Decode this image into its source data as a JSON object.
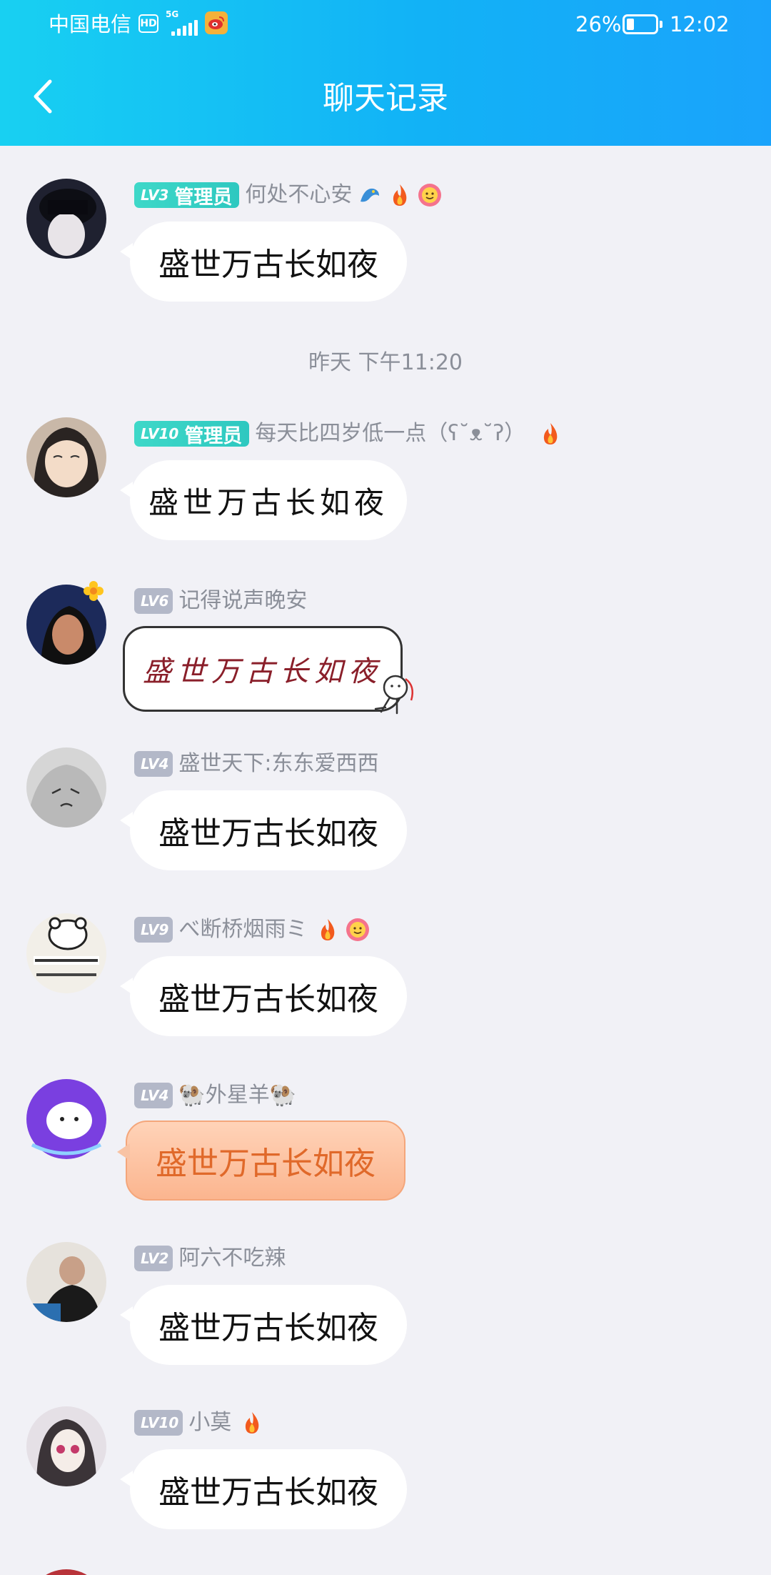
{
  "status_bar": {
    "carrier": "中国电信",
    "hd": "HD",
    "network": "5G",
    "battery_percent": "26%",
    "battery_level": 0.26,
    "time": "12:02",
    "icons": [
      "hd-icon",
      "signal-icon",
      "weibo-icon",
      "battery-icon"
    ]
  },
  "nav": {
    "title": "聊天记录",
    "back_icon": "chevron-left-icon"
  },
  "time_divider": "昨天 下午11:20",
  "messages": [
    {
      "level": "LV3",
      "role": "管理员",
      "nickname": "何处不心安",
      "emojis": [
        "dragon-emoji",
        "fire-emoji",
        "flower-emoji"
      ],
      "text": "盛世万古长如夜",
      "style": "plain",
      "avatar_color": "#1f2130"
    },
    {
      "level": "LV10",
      "role": "管理员",
      "nickname": "每天比四岁低一点（ʕ˘ᴥ˘ʔ）",
      "emojis": [
        "fire-emoji"
      ],
      "text": "盛世万古长如夜",
      "style": "calli",
      "avatar_color": "#c9b8a8"
    },
    {
      "level": "LV6",
      "role": "",
      "nickname": "记得说声晚安",
      "emojis": [],
      "text": "盛世万古长如夜",
      "style": "hand",
      "avatar_color": "#1c2a5a"
    },
    {
      "level": "LV4",
      "role": "",
      "nickname": "盛世天下:东东爱西西",
      "emojis": [],
      "text": "盛世万古长如夜",
      "style": "plain",
      "avatar_color": "#cfcfcf"
    },
    {
      "level": "LV9",
      "role": "",
      "nickname": "べ断桥烟雨ミ",
      "emojis": [
        "fire-emoji",
        "flower-emoji"
      ],
      "text": "盛世万古长如夜",
      "style": "plain",
      "avatar_color": "#e8e4e0"
    },
    {
      "level": "LV4",
      "role": "",
      "nickname": "🐏外星羊🐏",
      "emojis": [],
      "text": "盛世万古长如夜",
      "style": "orange",
      "avatar_color": "#7a3fe0"
    },
    {
      "level": "LV2",
      "role": "",
      "nickname": "阿六不吃辣",
      "emojis": [],
      "text": "盛世万古长如夜",
      "style": "plain",
      "avatar_color": "#6b5a4c"
    },
    {
      "level": "LV10",
      "role": "",
      "nickname": "小莫",
      "emojis": [
        "fire-emoji"
      ],
      "text": "盛世万古长如夜",
      "style": "plain",
      "avatar_color": "#e5e0e6"
    }
  ]
}
